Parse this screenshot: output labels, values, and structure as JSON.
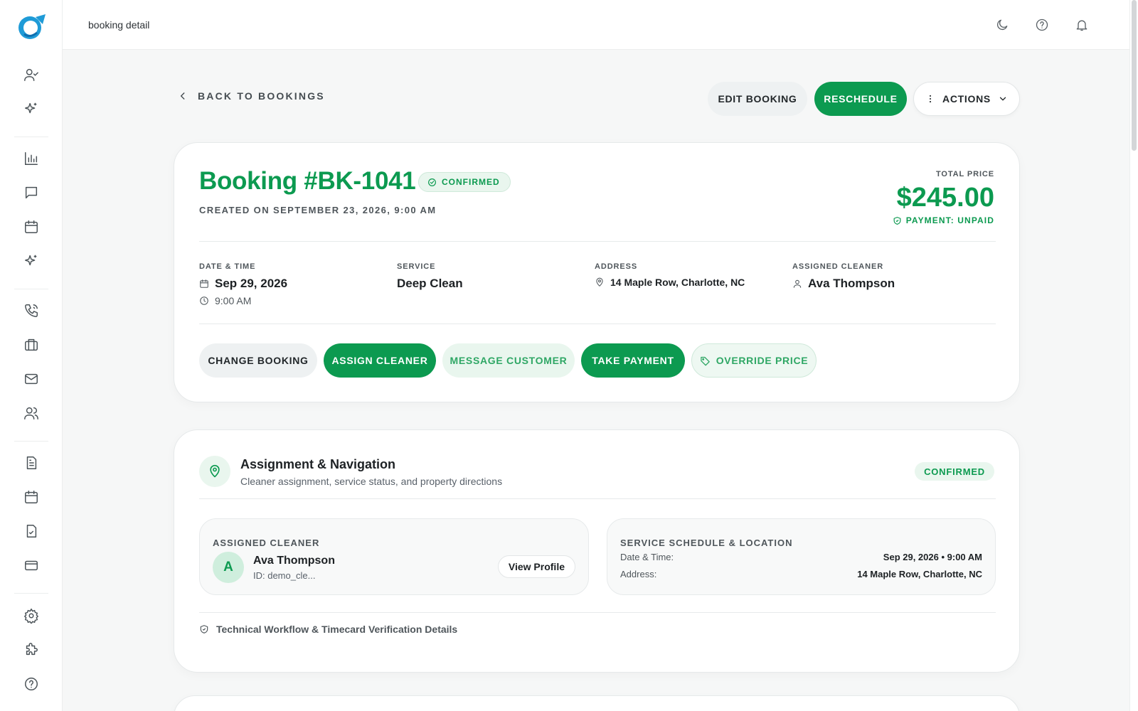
{
  "topbar": {
    "breadcrumb": "booking detail",
    "icons": [
      "moon-icon",
      "help-icon",
      "bell-icon"
    ]
  },
  "sidebar": {
    "items": [
      "user-check-icon",
      "sparkles-icon",
      "bar-chart-icon",
      "message-icon",
      "calendar-icon",
      "sparkles-icon",
      "phone-icon",
      "briefcase-icon",
      "mail-icon",
      "users-icon",
      "file-text-icon",
      "calendar-icon",
      "file-check-icon",
      "credit-card-icon",
      "settings-icon",
      "puzzle-icon",
      "help-icon"
    ]
  },
  "header": {
    "back_label": "BACK TO BOOKINGS",
    "edit_label": "EDIT BOOKING",
    "reschedule_label": "RESCHEDULE",
    "actions_label": "ACTIONS"
  },
  "booking": {
    "title": "Booking #BK-1041",
    "status": "CONFIRMED",
    "created": "CREATED ON SEPTEMBER 23, 2026, 9:00 AM",
    "total_label": "TOTAL PRICE",
    "total_value": "$245.00",
    "payment_status": "PAYMENT: UNPAID",
    "date_label": "DATE & TIME",
    "date_value": "Sep 29, 2026",
    "time_value": "9:00 AM",
    "service_label": "SERVICE",
    "service_value": "Deep Clean",
    "address_label": "ADDRESS",
    "address_value": "14 Maple Row, Charlotte, NC",
    "cleaner_label": "ASSIGNED CLEANER",
    "cleaner_value": "Ava Thompson"
  },
  "actions": {
    "change": "CHANGE BOOKING",
    "assign": "ASSIGN CLEANER",
    "message": "MESSAGE CUSTOMER",
    "payment": "TAKE PAYMENT",
    "override": "OVERRIDE PRICE"
  },
  "assignment": {
    "title": "Assignment & Navigation",
    "subtitle": "Cleaner assignment, service status, and property directions",
    "status": "CONFIRMED",
    "cleaner_section_label": "ASSIGNED CLEANER",
    "avatar_initial": "A",
    "cleaner_name": "Ava Thompson",
    "cleaner_id": "ID: demo_cle...",
    "view_profile": "View Profile",
    "schedule_section_label": "SERVICE SCHEDULE & LOCATION",
    "dt_key": "Date & Time:",
    "dt_value": "Sep 29, 2026 • 9:00 AM",
    "addr_key": "Address:",
    "addr_value": "14 Maple Row, Charlotte, NC",
    "tech_details": "Technical Workflow & Timecard Verification Details"
  },
  "colors": {
    "accent": "#0c9a50",
    "accent_soft": "#e9f6ee"
  }
}
